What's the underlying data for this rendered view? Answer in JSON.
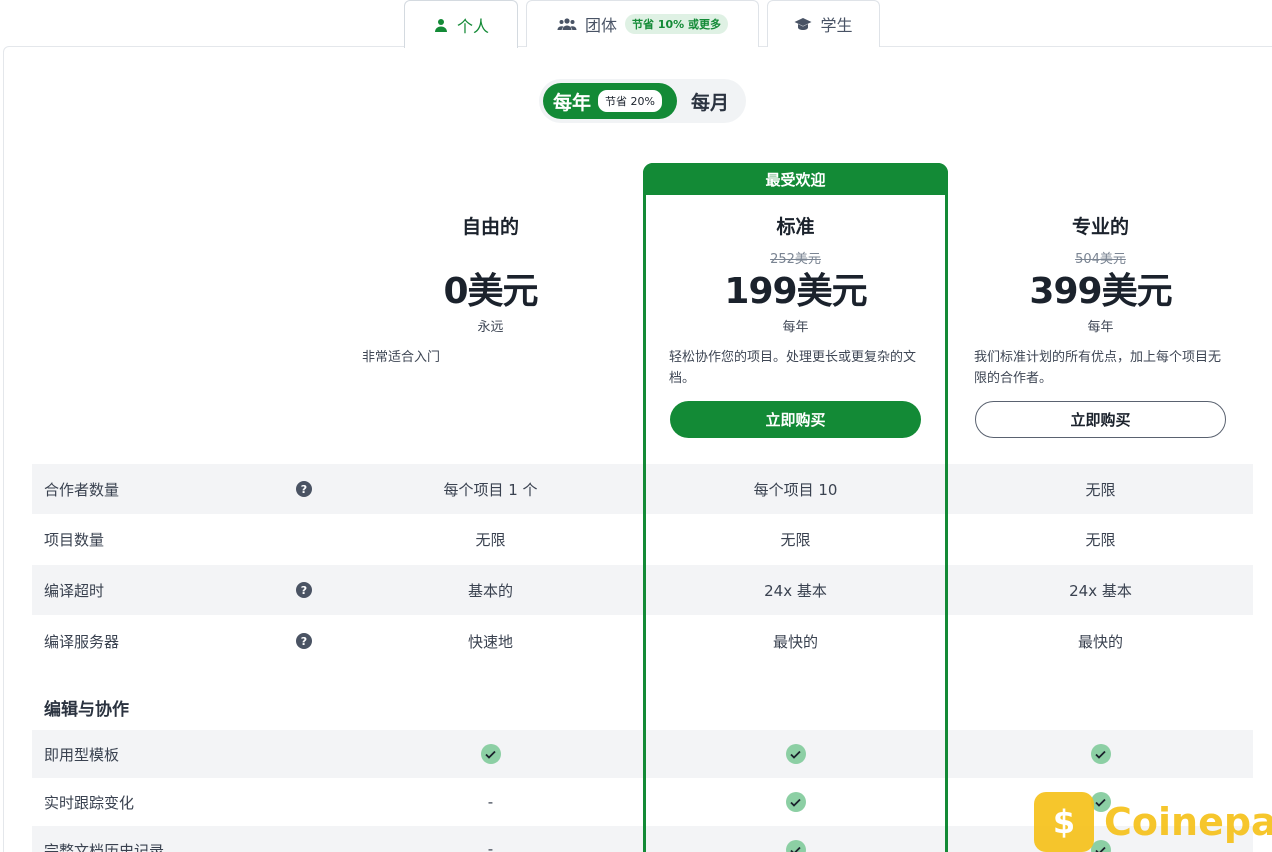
{
  "tabs": {
    "individual": "个人",
    "group": "团体",
    "group_badge": "节省 10% 或更多",
    "student": "学生"
  },
  "billing_toggle": {
    "annual": "每年",
    "annual_badge": "节省 20%",
    "monthly": "每月"
  },
  "popular_label": "最受欢迎",
  "plans": [
    {
      "name": "自由的",
      "old_price": "",
      "price": "0美元",
      "period": "永远",
      "description": "非常适合入门",
      "button": ""
    },
    {
      "name": "标准",
      "old_price": "252美元",
      "price": "199美元",
      "period": "每年",
      "description": "轻松协作您的项目。处理更长或更复杂的文档。",
      "button": "立即购买"
    },
    {
      "name": "专业的",
      "old_price": "504美元",
      "price": "399美元",
      "period": "每年",
      "description": "我们标准计划的所有优点，加上每个项目无限的合作者。",
      "button": "立即购买"
    }
  ],
  "feature_rows": [
    {
      "label": "合作者数量",
      "help": "?",
      "values": [
        "每个项目 1 个",
        "每个项目 10",
        "无限"
      ]
    },
    {
      "label": "项目数量",
      "values": [
        "无限",
        "无限",
        "无限"
      ]
    },
    {
      "label": "编译超时",
      "help": "?",
      "values": [
        "基本的",
        "24x 基本",
        "24x 基本"
      ]
    },
    {
      "label": "编译服务器",
      "help": "?",
      "values": [
        "快速地",
        "最快的",
        "最快的"
      ]
    }
  ],
  "section": {
    "title": "编辑与协作",
    "rows": [
      {
        "label": "即用型模板",
        "values": [
          "check",
          "check",
          "check"
        ]
      },
      {
        "label": "实时跟踪变化",
        "values": [
          "-",
          "check",
          "check"
        ]
      },
      {
        "label": "完整文档历史记录",
        "values": [
          "-",
          "check",
          "check"
        ]
      }
    ]
  },
  "watermark": {
    "text": "Coinepay",
    "symbol": "$"
  },
  "colors": {
    "brand_green": "#138a36",
    "check_green": "#8ccfa4",
    "watermark_yellow": "#f6c21b"
  }
}
